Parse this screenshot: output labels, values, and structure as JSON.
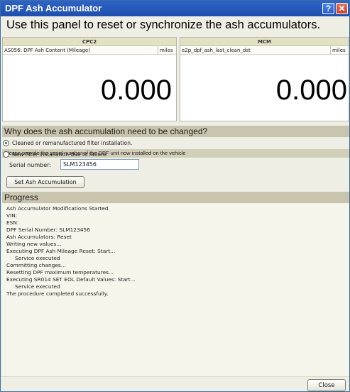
{
  "window": {
    "title": "DPF Ash Accumulator",
    "help_glyph": "?",
    "close_glyph": "✕"
  },
  "heading": "Use this panel to reset or synchronize the ash accumulators.",
  "counters": {
    "cpc2": {
      "header": "CPC2",
      "label": "AS056: DPF Ash Content (Mileage)",
      "unit": "miles",
      "value": "0.000"
    },
    "mcm": {
      "header": "MCM",
      "label": "e2p_dpf_ash_last_clean_dst",
      "unit": "miles",
      "value": "0.000"
    }
  },
  "reason": {
    "question": "Why does the ash accumulation need to be changed?",
    "options": [
      {
        "label": "Cleaned or remanufactured filter installation.",
        "selected": true
      },
      {
        "label": "New filter installation due to failure.",
        "selected": false
      }
    ]
  },
  "serial": {
    "instruction": "Please provide the serial number of the DPF unit now installed on the vehicle",
    "label": "Serial number:",
    "value": "SLM123456"
  },
  "set_button_label": "Set Ash Accumulation",
  "progress": {
    "heading": "Progress",
    "lines": [
      "Ash Accumulator Modifications Started.",
      "VIN:",
      "ESN:",
      "DPF Serial Number: SLM123456",
      "Ash Accumulators: Reset",
      "Writing new values...",
      "Executing DPF Ash Mileage Reset: Start...",
      "Service executed",
      "Committing changes...",
      "Resetting DPF maximum temperatures...",
      "Executing SR014 SET EOL Default Values: Start...",
      "Service executed",
      "The procedure completed successfully."
    ]
  },
  "close_button_label": "Close"
}
